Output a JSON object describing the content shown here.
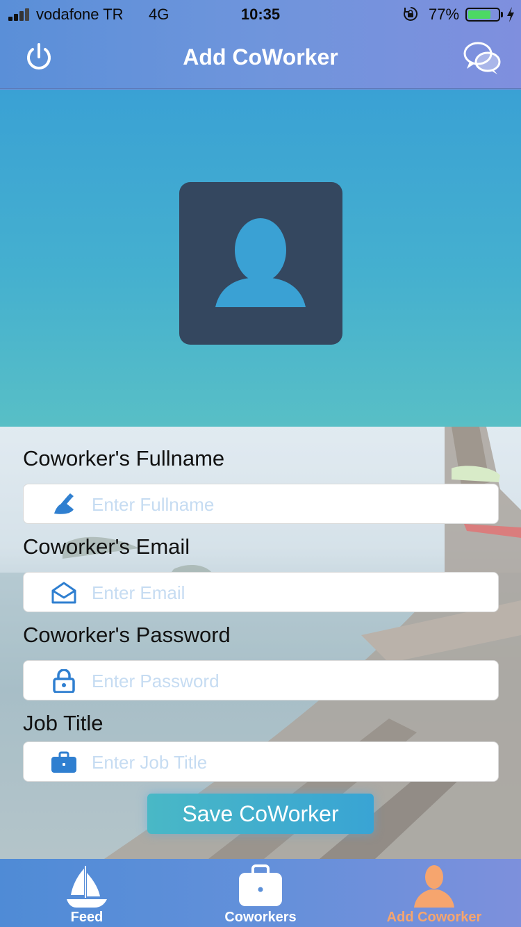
{
  "status_bar": {
    "carrier": "vodafone TR",
    "network": "4G",
    "time": "10:35",
    "battery_percent": "77%",
    "battery_level": 0.77
  },
  "nav": {
    "title": "Add CoWorker",
    "left_icon": "power-icon",
    "right_icon": "chat-bubbles-icon"
  },
  "avatar": {
    "icon": "person-silhouette-icon"
  },
  "form": {
    "fullname": {
      "label": "Coworker's Fullname",
      "placeholder": "Enter Fullname",
      "icon": "pen-writing-icon"
    },
    "email": {
      "label": "Coworker's Email",
      "placeholder": "Enter Email",
      "icon": "envelope-icon"
    },
    "password": {
      "label": "Coworker's Password",
      "placeholder": "Enter Password",
      "icon": "padlock-icon"
    },
    "job_title": {
      "label": "Job Title",
      "placeholder": "Enter Job Title",
      "icon": "briefcase-icon"
    },
    "save_label": "Save CoWorker"
  },
  "tabs": [
    {
      "label": "Feed",
      "icon": "sailboat-icon",
      "active": false
    },
    {
      "label": "Coworkers",
      "icon": "briefcase-icon",
      "active": false
    },
    {
      "label": "Add Coworker",
      "icon": "person-icon",
      "active": true
    }
  ],
  "colors": {
    "accent_blue": "#2f7fd0",
    "active_tab": "#f6a56e",
    "avatar_bg": "#34475f",
    "battery_green": "#4cd964"
  }
}
